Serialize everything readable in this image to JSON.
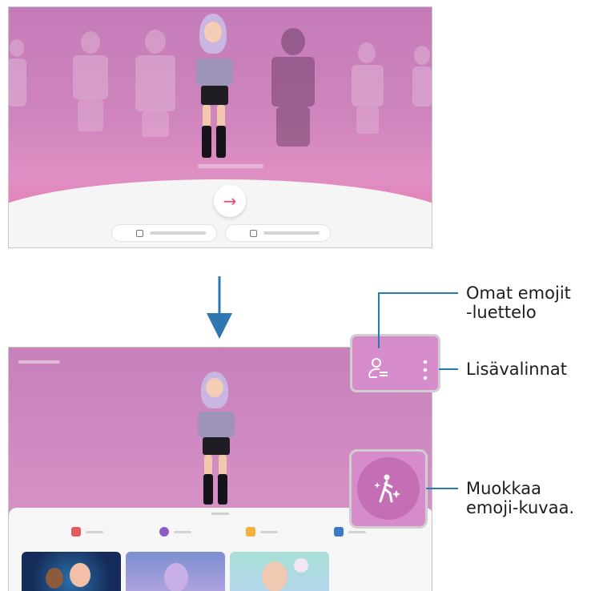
{
  "annotations": {
    "my_emojis_line1": "Omat emojit",
    "my_emojis_line2": "-luettelo",
    "more_options": "Lisävalinnat",
    "edit_line1": "Muokkaa",
    "edit_line2": "emoji-kuvaa."
  },
  "top_screen": {
    "next_arrow_icon": "→"
  },
  "icons": {
    "my_emojis_list": "person-list-icon",
    "more_options": "vertical-dots-icon",
    "edit_emoji": "walking-sparkle-icon",
    "flow": "down-arrow-icon"
  },
  "colors": {
    "accent_line": "#1f7fb5",
    "screen_pink": "#cf84bd",
    "next_arrow": "#e14c7b"
  }
}
